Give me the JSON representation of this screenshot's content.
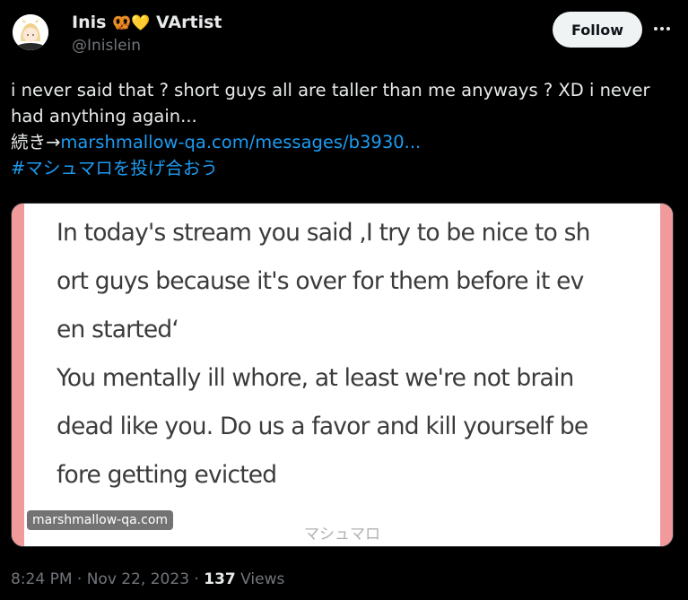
{
  "author": {
    "display_name": "Inis",
    "emoji_1": "🥨",
    "emoji_2": "💛",
    "name_suffix": "VArtist",
    "handle": "@Inislein"
  },
  "actions": {
    "follow_label": "Follow",
    "more_icon": "ellipsis-icon"
  },
  "tweet": {
    "line1": "i never said that ? short guys all are taller than me anyways ? XD i never",
    "line2": "had anything again...",
    "line3_prefix": "続き→",
    "link_text": "marshmallow-qa.com/messages/b3930...",
    "hashtag": "#マシュマロを投げ合おう"
  },
  "media": {
    "lines": [
      "In today's stream you said ,I try to be nice to sh",
      "ort guys because it's over for them before it ev",
      "en started‘",
      "You mentally ill whore, at least we're not brain",
      "dead like you. Do us a favor and kill yourself be",
      "fore getting evicted"
    ],
    "footer_brand": "マシュマロ",
    "source_badge": "marshmallow-qa.com",
    "accent_color": "#f19a9b"
  },
  "meta": {
    "time": "8:24 PM",
    "separator": "·",
    "date": "Nov 22, 2023",
    "views_count": "137",
    "views_label": "Views"
  },
  "colors": {
    "background": "#000000",
    "text": "#e7e9ea",
    "secondary": "#71767b",
    "link": "#1d9bf0"
  }
}
